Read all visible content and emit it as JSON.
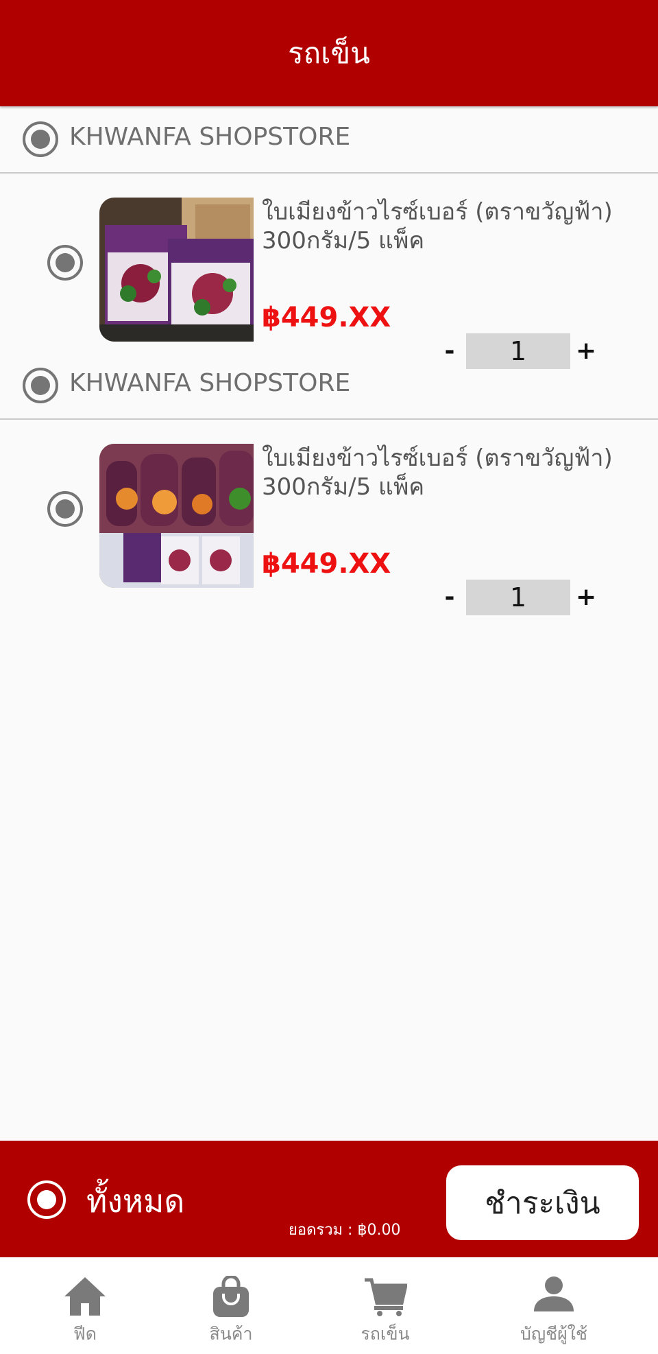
{
  "header": {
    "title": "รถเข็น"
  },
  "stores": [
    {
      "name": "KHWANFA SHOPSTORE",
      "item": {
        "title": "ใบเมียงข้าวไรซ์เบอร์ (ตราขวัญฟ้า) 300กรัม/5 แพ็ค",
        "price": "฿449.XX",
        "qty": "1",
        "image": "product-packages-photo"
      }
    },
    {
      "name": "KHWANFA SHOPSTORE",
      "item": {
        "title": "ใบเมียงข้าวไรซ์เบอร์ (ตราขวัญฟ้า) 300กรัม/5 แพ็ค",
        "price": "฿449.XX",
        "qty": "1",
        "image": "spring-rolls-photo"
      }
    }
  ],
  "qty_controls": {
    "minus": "-",
    "plus": "+"
  },
  "footer": {
    "select_all_label": "ทั้งหมด",
    "total_text": "ยอดรวม : ฿0.00",
    "checkout_label": "ชำระเงิน"
  },
  "tabbar": {
    "items": [
      {
        "label": "ฟีด",
        "icon": "home-icon"
      },
      {
        "label": "สินค้า",
        "icon": "shopping-bag-icon"
      },
      {
        "label": "รถเข็น",
        "icon": "cart-icon"
      },
      {
        "label": "บัญชีผู้ใช้",
        "icon": "user-icon"
      }
    ]
  },
  "colors": {
    "brand": "#b10000",
    "price": "#ee1111",
    "muted": "#757575"
  }
}
